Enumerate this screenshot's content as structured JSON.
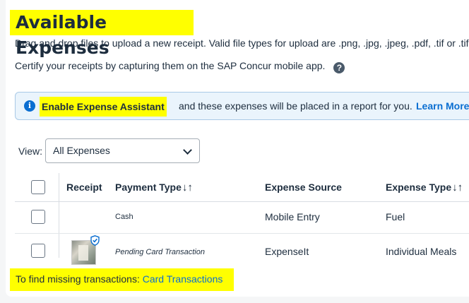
{
  "page": {
    "title": "Available Expenses",
    "upload_hint": "Drag and drop files to upload a new receipt. Valid file types for upload are .png, .jpg, .jpeg, .pdf, .tif or .tif",
    "certify_text": "Certify your receipts by capturing them on the SAP Concur mobile app.",
    "help_glyph": "?"
  },
  "banner": {
    "info_glyph": "i",
    "strong": "Enable Expense Assistant",
    "text": "and these expenses will be placed in a report for you.",
    "link": "Learn More"
  },
  "view": {
    "label": "View:",
    "selected": "All Expenses"
  },
  "table": {
    "columns": [
      "Receipt",
      "Payment Type",
      "Expense Source",
      "Expense Type"
    ],
    "sort_glyph": "↓↑",
    "rows": [
      {
        "receipt": "",
        "payment_type": "Cash",
        "expense_source": "Mobile Entry",
        "expense_type": "Fuel"
      },
      {
        "receipt": "receipt-thumbnail",
        "payment_type": "Pending Card Transaction",
        "expense_source": "ExpenseIt",
        "expense_type": "Individual Meals"
      }
    ]
  },
  "footer": {
    "text": "To find missing transactions:",
    "link": "Card Transactions"
  },
  "colors": {
    "highlight": "#ffff00",
    "link": "#0a6ed1",
    "banner_bg": "#eaf4fc",
    "text": "#1d2d3e"
  },
  "icons": {
    "help": "help-icon",
    "info": "info-icon",
    "dropdown": "chevron-down-icon",
    "verified": "shield-check-icon"
  }
}
